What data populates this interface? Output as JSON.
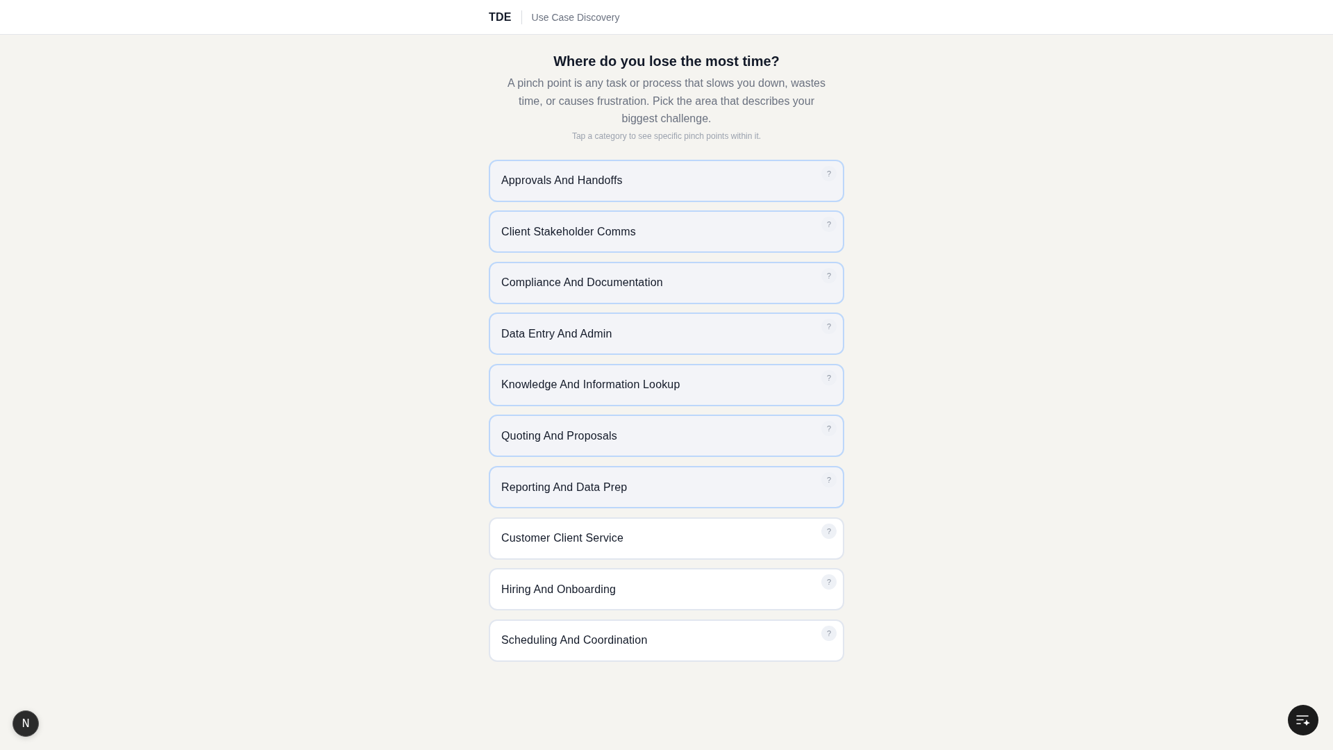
{
  "header": {
    "brand": "TDE",
    "title": "Use Case Discovery"
  },
  "intro": {
    "heading": "Where do you lose the most time?",
    "description": "A pinch point is any task or process that slows you down, wastes time, or causes frustration. Pick the area that describes your biggest challenge.",
    "hint": "Tap a category to see specific pinch points within it."
  },
  "categories": [
    {
      "label": "Approvals And Handoffs",
      "help": "?",
      "selected": true
    },
    {
      "label": "Client Stakeholder Comms",
      "help": "?",
      "selected": true
    },
    {
      "label": "Compliance And Documentation",
      "help": "?",
      "selected": true
    },
    {
      "label": "Data Entry And Admin",
      "help": "?",
      "selected": true
    },
    {
      "label": "Knowledge And Information Lookup",
      "help": "?",
      "selected": true
    },
    {
      "label": "Quoting And Proposals",
      "help": "?",
      "selected": true
    },
    {
      "label": "Reporting And Data Prep",
      "help": "?",
      "selected": true
    },
    {
      "label": "Customer Client Service",
      "help": "?",
      "selected": false
    },
    {
      "label": "Hiring And Onboarding",
      "help": "?",
      "selected": false
    },
    {
      "label": "Scheduling And Coordination",
      "help": "?",
      "selected": false
    }
  ],
  "dev_tools_button": {
    "label": "N"
  }
}
